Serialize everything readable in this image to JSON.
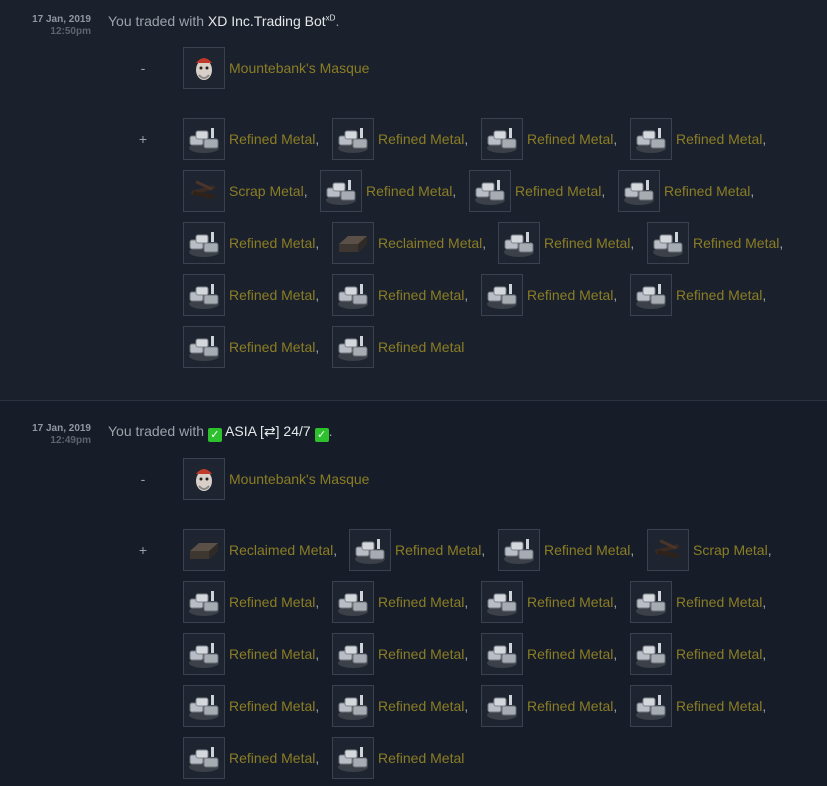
{
  "trades": [
    {
      "date": "17 Jan, 2019",
      "time": "12:50pm",
      "prefix": "You traded with",
      "partner": "XD Inc.Trading Bot",
      "partner_suffix": "xD",
      "end": ".",
      "gave_sign": "-",
      "got_sign": "+",
      "gave": [
        {
          "name": "Mountebank's Masque",
          "icon": "masque-icon"
        }
      ],
      "got_rows": [
        [
          {
            "name": "Refined Metal",
            "sep": ",",
            "icon": "refined-metal-icon"
          },
          {
            "name": "Refined Metal",
            "sep": ",",
            "icon": "refined-metal-icon"
          },
          {
            "name": "Refined Metal",
            "sep": ",",
            "icon": "refined-metal-icon"
          },
          {
            "name": "Refined Metal",
            "sep": ",",
            "icon": "refined-metal-icon"
          }
        ],
        [
          {
            "name": "Scrap Metal",
            "sep": ",",
            "icon": "scrap-metal-icon"
          },
          {
            "name": "Refined Metal",
            "sep": ",",
            "icon": "refined-metal-icon"
          },
          {
            "name": "Refined Metal",
            "sep": ",",
            "icon": "refined-metal-icon"
          },
          {
            "name": "Refined Metal",
            "sep": ",",
            "icon": "refined-metal-icon"
          }
        ],
        [
          {
            "name": "Refined Metal",
            "sep": ",",
            "icon": "refined-metal-icon"
          },
          {
            "name": "Reclaimed Metal",
            "sep": ",",
            "icon": "reclaimed-metal-icon"
          },
          {
            "name": "Refined Metal",
            "sep": ",",
            "icon": "refined-metal-icon"
          },
          {
            "name": "Refined Metal",
            "sep": ",",
            "icon": "refined-metal-icon"
          }
        ],
        [
          {
            "name": "Refined Metal",
            "sep": ",",
            "icon": "refined-metal-icon"
          },
          {
            "name": "Refined Metal",
            "sep": ",",
            "icon": "refined-metal-icon"
          },
          {
            "name": "Refined Metal",
            "sep": ",",
            "icon": "refined-metal-icon"
          },
          {
            "name": "Refined Metal",
            "sep": ",",
            "icon": "refined-metal-icon"
          }
        ],
        [
          {
            "name": "Refined Metal",
            "sep": ",",
            "icon": "refined-metal-icon"
          },
          {
            "name": "Refined Metal",
            "sep": "",
            "icon": "refined-metal-icon"
          }
        ]
      ]
    },
    {
      "date": "17 Jan, 2019",
      "time": "12:49pm",
      "prefix": "You traded with",
      "partner": "ASIA [⇄] 24/7",
      "check": "✓",
      "end": ".",
      "gave_sign": "-",
      "got_sign": "+",
      "gave": [
        {
          "name": "Mountebank's Masque",
          "icon": "masque-icon"
        }
      ],
      "got_rows": [
        [
          {
            "name": "Reclaimed Metal",
            "sep": ",",
            "icon": "reclaimed-metal-icon"
          },
          {
            "name": "Refined Metal",
            "sep": ",",
            "icon": "refined-metal-icon"
          },
          {
            "name": "Refined Metal",
            "sep": ",",
            "icon": "refined-metal-icon"
          },
          {
            "name": "Scrap Metal",
            "sep": ",",
            "icon": "scrap-metal-icon"
          }
        ],
        [
          {
            "name": "Refined Metal",
            "sep": ",",
            "icon": "refined-metal-icon"
          },
          {
            "name": "Refined Metal",
            "sep": ",",
            "icon": "refined-metal-icon"
          },
          {
            "name": "Refined Metal",
            "sep": ",",
            "icon": "refined-metal-icon"
          },
          {
            "name": "Refined Metal",
            "sep": ",",
            "icon": "refined-metal-icon"
          }
        ],
        [
          {
            "name": "Refined Metal",
            "sep": ",",
            "icon": "refined-metal-icon"
          },
          {
            "name": "Refined Metal",
            "sep": ",",
            "icon": "refined-metal-icon"
          },
          {
            "name": "Refined Metal",
            "sep": ",",
            "icon": "refined-metal-icon"
          },
          {
            "name": "Refined Metal",
            "sep": ",",
            "icon": "refined-metal-icon"
          }
        ],
        [
          {
            "name": "Refined Metal",
            "sep": ",",
            "icon": "refined-metal-icon"
          },
          {
            "name": "Refined Metal",
            "sep": ",",
            "icon": "refined-metal-icon"
          },
          {
            "name": "Refined Metal",
            "sep": ",",
            "icon": "refined-metal-icon"
          },
          {
            "name": "Refined Metal",
            "sep": ",",
            "icon": "refined-metal-icon"
          }
        ],
        [
          {
            "name": "Refined Metal",
            "sep": ",",
            "icon": "refined-metal-icon"
          },
          {
            "name": "Refined Metal",
            "sep": "",
            "icon": "refined-metal-icon"
          }
        ]
      ]
    }
  ],
  "colors": {
    "item_name": "#8b7d25",
    "partner": "#e6e8ea",
    "check": "#2dc12d"
  }
}
